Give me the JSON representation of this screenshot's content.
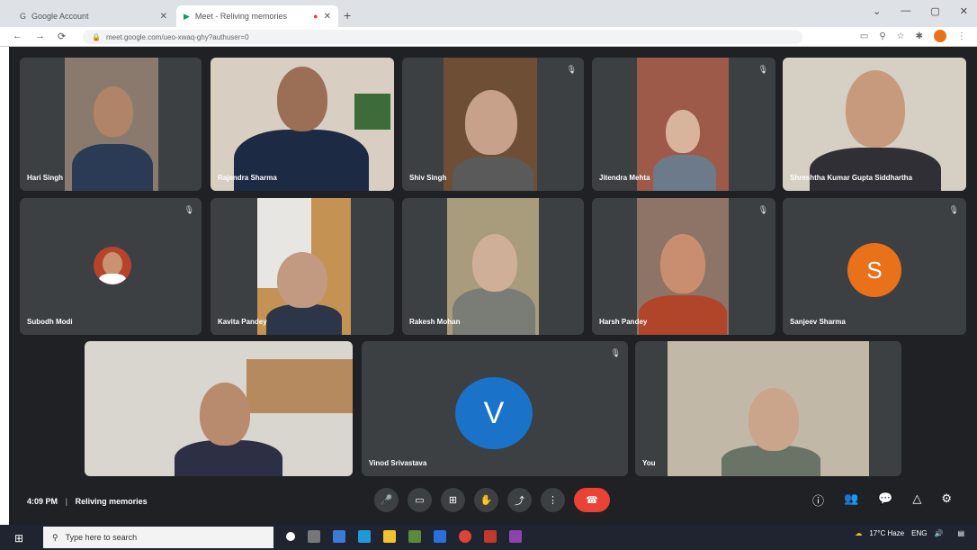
{
  "browser": {
    "tabs": [
      {
        "label": "Google Account",
        "close": "✕"
      },
      {
        "label": "Meet - Reliving memories",
        "close": "✕"
      }
    ],
    "new_tab": "+",
    "window_controls": [
      "⌄",
      "—",
      "▢",
      "✕"
    ],
    "nav": [
      "←",
      "→",
      "⟳"
    ],
    "url": "meet.google.com/ueo-xwaq-ghy?authuser=0",
    "extensions": [
      "▭",
      "⚲",
      "☆",
      "✱"
    ],
    "profile_initial": "",
    "menu": "⋮"
  },
  "meet": {
    "participants": [
      {
        "name": "Hari Singh",
        "muted": false
      },
      {
        "name": "Rajendra Sharma",
        "muted": false
      },
      {
        "name": "Shiv Singh",
        "muted": true
      },
      {
        "name": "Jitendra Mehta",
        "muted": true
      },
      {
        "name": "Shreshtha Kumar Gupta Siddhartha",
        "muted": false
      },
      {
        "name": "Subodh Modi",
        "muted": true
      },
      {
        "name": "Kavita Pandey",
        "muted": false
      },
      {
        "name": "Rakesh Mohan",
        "muted": false
      },
      {
        "name": "Harsh Pandey",
        "muted": true
      },
      {
        "name": "Sanjeev Sharma",
        "muted": true,
        "initial": "S",
        "avatar_color": "#e8711a"
      },
      {
        "name": "",
        "muted": false
      },
      {
        "name": "Vinod Srivastava",
        "muted": true,
        "initial": "V",
        "avatar_color": "#1a73c8"
      },
      {
        "name": "You",
        "muted": false
      }
    ],
    "time": "4:09 PM",
    "separator": "|",
    "meeting_title": "Reliving memories",
    "controls": [
      "🎤",
      "▭",
      "⊞",
      "✋",
      "⤴",
      "⋮",
      "☎"
    ],
    "right_controls": [
      "ⓘ",
      "👥",
      "💬",
      "△",
      "⚙"
    ]
  },
  "taskbar": {
    "start": "⊞",
    "search_placeholder": "Type here to search",
    "search_icon": "⚲",
    "tray_text": "17°C Haze",
    "tray_icons": "ENG",
    "clock_time": "",
    "clock_date": ""
  },
  "colors": {
    "meet_bg": "#202124",
    "tile_bg": "#3c4043",
    "end_call": "#ea4335"
  }
}
